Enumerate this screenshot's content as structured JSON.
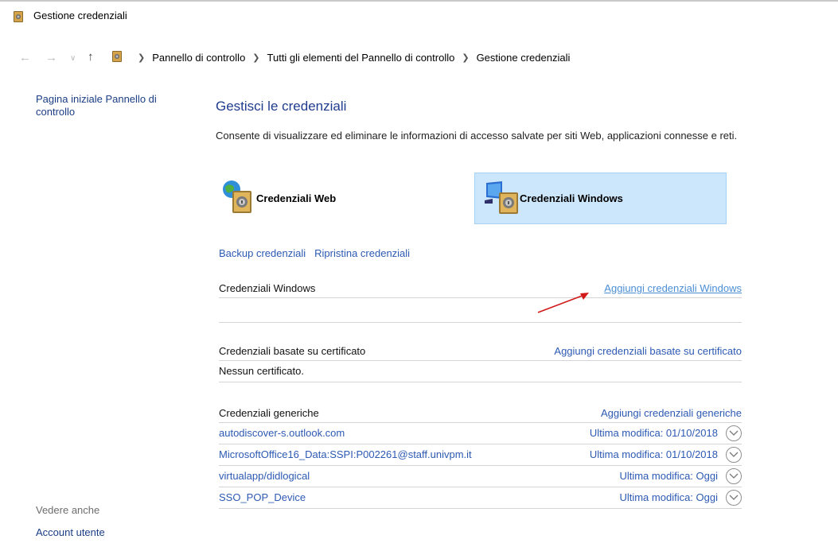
{
  "window": {
    "title": "Gestione credenziali"
  },
  "address": {
    "crumbs": [
      "Pannello di controllo",
      "Tutti gli elementi del Pannello di controllo",
      "Gestione credenziali"
    ]
  },
  "sidebar": {
    "home_link": "Pagina iniziale Pannello di controllo",
    "see_also_heading": "Vedere anche",
    "account_link": "Account utente"
  },
  "main": {
    "title": "Gestisci le credenziali",
    "description": "Consente di visualizzare ed eliminare le informazioni di accesso salvate per siti Web, applicazioni connesse e reti.",
    "tabs": [
      {
        "label": "Credenziali Web",
        "selected": false
      },
      {
        "label": "Credenziali Windows",
        "selected": true
      }
    ],
    "backup_link": "Backup credenziali",
    "restore_link": "Ripristina credenziali",
    "windows_section": {
      "name": "Credenziali Windows",
      "add_link": "Aggiungi credenziali Windows"
    },
    "cert_section": {
      "name": "Credenziali basate su certificato",
      "add_link": "Aggiungi credenziali basate su certificato",
      "empty_text": "Nessun certificato."
    },
    "generic_section": {
      "name": "Credenziali generiche",
      "add_link": "Aggiungi credenziali generiche",
      "items": [
        {
          "name": "autodiscover-s.outlook.com",
          "modified": "Ultima modifica: 01/10/2018"
        },
        {
          "name": "MicrosoftOffice16_Data:SSPI:P002261@staff.univpm.it",
          "modified": "Ultima modifica: 01/10/2018"
        },
        {
          "name": "virtualapp/didlogical",
          "modified": "Ultima modifica: Oggi"
        },
        {
          "name": "SSO_POP_Device",
          "modified": "Ultima modifica: Oggi"
        }
      ]
    }
  },
  "colors": {
    "link": "#2d5ab3",
    "selected_tab_bg": "#cce6fb",
    "annotation_arrow": "#d11a1a"
  }
}
